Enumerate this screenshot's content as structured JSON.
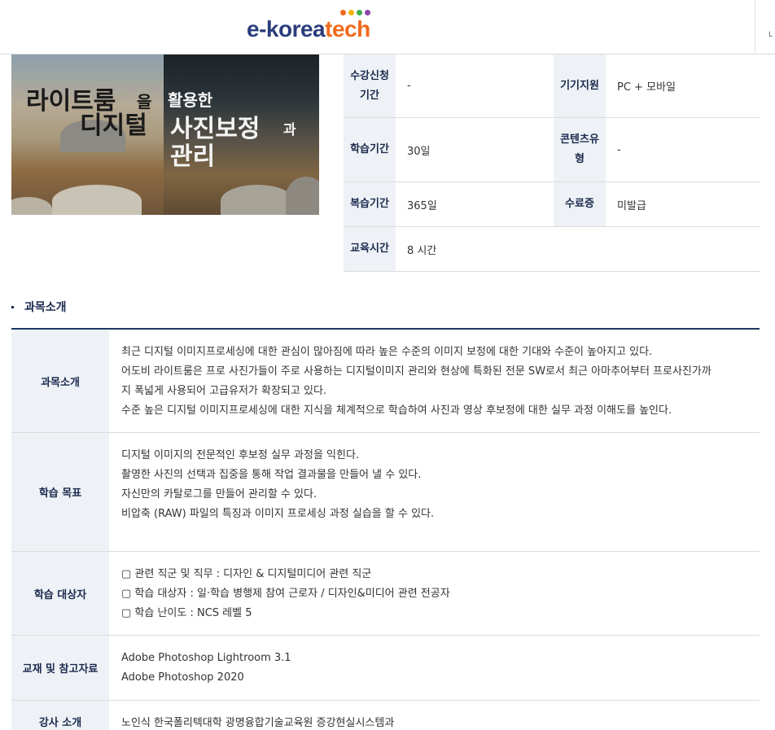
{
  "header": {
    "logo_part1": "e-korea",
    "logo_part2": "tech",
    "logo_dot_colors": [
      "#f26a1b",
      "#f5b400",
      "#3fae49",
      "#8e44ad"
    ],
    "edge_text": "L"
  },
  "thumbnail": {
    "title_line1a": "라이트룸",
    "title_line1b": "을",
    "title_line1c": "활용한",
    "title_line2a": "디지털",
    "title_line2b": "사진보정",
    "title_line2c": "과",
    "title_line3": "관리"
  },
  "info": {
    "rows": [
      {
        "label1": "수강신청\n기간",
        "value1": "-",
        "label2": "기기지원",
        "value2": "PC + 모바일"
      },
      {
        "label1": "학습기간",
        "value1": "30일",
        "label2": "콘텐츠유\n형",
        "value2": "-"
      },
      {
        "label1": "복습기간",
        "value1": "365일",
        "label2": "수료증",
        "value2": "미발급"
      },
      {
        "label1": "교육시간",
        "value1": "8 시간",
        "label2": "",
        "value2": ""
      }
    ]
  },
  "section": {
    "title": "과목소개"
  },
  "detail": {
    "rows": [
      {
        "label": "과목소개",
        "lines": [
          "최근 디지털 이미지프로세싱에 대한 관심이 많아짐에 따라 높은 수준의 이미지 보정에 대한 기대와 수준이 높아지고 있다.",
          "어도비 라이트룸은 프로 사진가들이 주로 사용하는 디지털이미지 관리와 현상에 특화된 전문 SW로서 최근 아마추어부터 프로사진가까",
          "지 폭넓게 사용되어 고급유저가 확장되고 있다.",
          "수준 높은 디지털 이미지프로세싱에 대한 지식을 체계적으로 학습하여 사진과 영상 후보정에 대한 실무 과정 이해도를 높인다."
        ]
      },
      {
        "label": "학습 목표",
        "lines": [
          "디지털 이미지의 전문적인 후보정 실무 과정을 익힌다.",
          "촬영한 사진의 선택과 집중을 통해 작업 결과물을 만들어 낼 수 있다.",
          "자신만의 카탈로그를 만들어 관리할 수 있다.",
          "비압축 (RAW) 파일의 특징과 이미지 프로세싱 과정 실습을 할 수 있다."
        ]
      },
      {
        "label": "학습 대상자",
        "lines": [
          "▢ 관련 직군 및 직무 : 디자인 & 디지털미디어 관련 직군",
          "▢ 학습 대상자 : 일·학습 병행제 참여 근로자 / 디자인&미디어 관련 전공자",
          "▢ 학습 난이도 : NCS 레벨 5"
        ]
      },
      {
        "label": "교재 및 참고자료",
        "lines": [
          "Adobe Photoshop Lightroom 3.1",
          "Adobe Photoshop 2020"
        ]
      },
      {
        "label": "강사 소개",
        "lines": [
          "노인식 한국폴리텍대학 광명융합기술교육원 증강현실시스템과"
        ]
      }
    ]
  }
}
